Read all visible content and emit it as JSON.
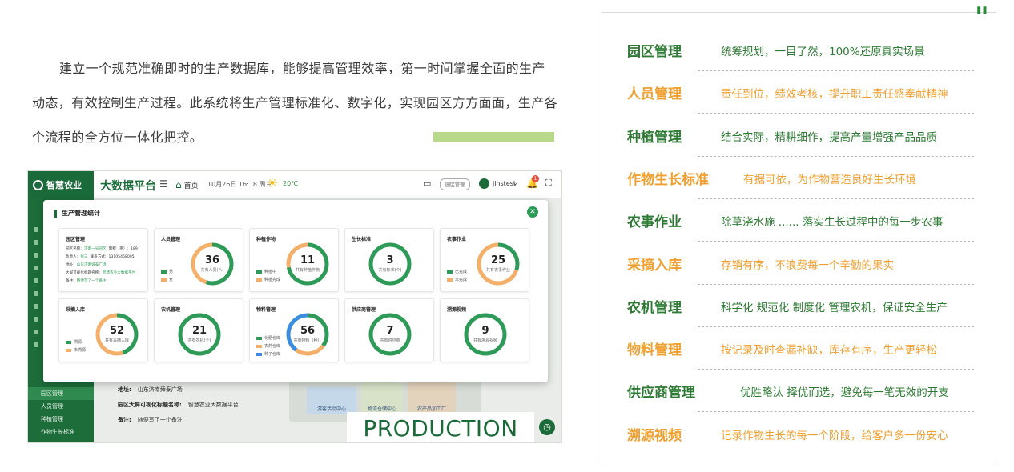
{
  "intro": {
    "text": "建立一个规范准确即时的生产数据库，能够提高管理效率，第一时间掌握全面的生产动态，有效控制生产过程。此系统将生产管理标准化、数字化，实现园区方方面面，生产各个流程的全方位一体化把控。"
  },
  "app": {
    "brand": "智慧农业",
    "platform": "大数据平台",
    "home_label": "首页",
    "datetime": "10月26日 16:18 周三",
    "temperature": "20℃",
    "park_button": "园区管理",
    "username": "jinstest",
    "notification_count": "1",
    "sidebar_menu": [
      {
        "label": "园区管理",
        "active": true
      },
      {
        "label": "人员管理",
        "active": false
      },
      {
        "label": "种植管理",
        "active": false
      },
      {
        "label": "作物生长标准",
        "active": false
      }
    ],
    "background_info": {
      "address_label": "地址:",
      "address_value": "山东济南舜泰广场",
      "screen_label": "园区大屏可视化标题名称:",
      "screen_value": "智慧农业大数据平台",
      "note_label": "备注:",
      "note_value": "随便写了一个备注"
    },
    "map_labels": [
      "游客活动中心",
      "物流仓储中心",
      "农产品加工厂"
    ],
    "production_text": "PRODUCTION",
    "modal": {
      "title": "生产管理统计",
      "park_card": {
        "title": "园区管理",
        "lines": [
          {
            "label": "园区名称:",
            "value": "济南一号园区",
            "extra": "面积（亩）:",
            "extra_value": "189"
          },
          {
            "label": "负责人:",
            "value": "张三",
            "extra": "联系方式:",
            "extra_value": "13105468005"
          },
          {
            "label": "地址:",
            "value": "山东济南舜泰广场",
            "extra": "",
            "extra_value": ""
          },
          {
            "label": "大屏可视化标题名称:",
            "value": "智慧农业大数据平台",
            "extra": "",
            "extra_value": ""
          },
          {
            "label": "备注:",
            "value": "随便写了一个备注",
            "extra": "",
            "extra_value": ""
          }
        ]
      },
      "cards": [
        {
          "title": "人员管理",
          "value": "36",
          "caption": "共有人员(人)",
          "segments": [
            {
              "frac": 0.55,
              "color": "#2e9a57"
            },
            {
              "frac": 0.45,
              "color": "#f4b06a"
            }
          ],
          "legend": [
            {
              "label": "男",
              "color": "#2e9a57"
            },
            {
              "label": "女",
              "color": "#f4b06a"
            }
          ]
        },
        {
          "title": "种植作物",
          "value": "11",
          "caption": "共有种植作物",
          "segments": [
            {
              "frac": 0.72,
              "color": "#2e9a57"
            },
            {
              "frac": 0.28,
              "color": "#f4b06a"
            }
          ],
          "legend": [
            {
              "label": "种植中",
              "color": "#2e9a57"
            },
            {
              "label": "种植完成",
              "color": "#f4b06a"
            }
          ]
        },
        {
          "title": "生长标准",
          "value": "3",
          "caption": "共有标准(个)",
          "segments": [
            {
              "frac": 1.0,
              "color": "#2e9a57"
            }
          ],
          "legend": []
        },
        {
          "title": "农事作业",
          "value": "25",
          "caption": "共有农事作业",
          "segments": [
            {
              "frac": 0.3,
              "color": "#2e9a57"
            },
            {
              "frac": 0.7,
              "color": "#f4b06a"
            }
          ],
          "legend": [
            {
              "label": "已完成",
              "color": "#2e9a57"
            },
            {
              "label": "未完成",
              "color": "#f4b06a"
            }
          ]
        },
        {
          "title": "采摘入库",
          "value": "52",
          "caption": "共有采摘入库",
          "segments": [
            {
              "frac": 0.45,
              "color": "#2e9a57"
            },
            {
              "frac": 0.55,
              "color": "#f4b06a"
            }
          ],
          "legend": [
            {
              "label": "溯源",
              "color": "#2e9a57"
            },
            {
              "label": "未溯源",
              "color": "#f4b06a"
            }
          ]
        },
        {
          "title": "农机管理",
          "value": "21",
          "caption": "共有农机(个)",
          "segments": [
            {
              "frac": 1.0,
              "color": "#2e9a57"
            }
          ],
          "legend": []
        },
        {
          "title": "物料管理",
          "value": "56",
          "caption": "共有物料（种）",
          "segments": [
            {
              "frac": 0.35,
              "color": "#2e9a57"
            },
            {
              "frac": 0.25,
              "color": "#f4b06a"
            },
            {
              "frac": 0.4,
              "color": "#3b8de0"
            }
          ],
          "legend": [
            {
              "label": "化肥仓库",
              "color": "#2e9a57"
            },
            {
              "label": "农药仓库",
              "color": "#f4b06a"
            },
            {
              "label": "种子仓库",
              "color": "#3b8de0"
            }
          ]
        },
        {
          "title": "供应商管理",
          "value": "7",
          "caption": "共有供应商",
          "segments": [
            {
              "frac": 1.0,
              "color": "#2e9a57"
            }
          ],
          "legend": []
        },
        {
          "title": "溯源视频",
          "value": "9",
          "caption": "共有溯源视频",
          "segments": [
            {
              "frac": 1.0,
              "color": "#2e9a57"
            }
          ],
          "legend": []
        }
      ]
    }
  },
  "features": [
    {
      "name": "园区管理",
      "desc": "统筹规划，一目了然，100%还原真实场景",
      "color": "green"
    },
    {
      "name": "人员管理",
      "desc": "责任到位，绩效考核，提升职工责任感奉献精神",
      "color": "orange"
    },
    {
      "name": "种植管理",
      "desc": "结合实际，精耕细作，提高产量增强产品品质",
      "color": "green"
    },
    {
      "name": "作物生长标准",
      "desc": "有据可依，为作物营造良好生长环境",
      "color": "orange"
    },
    {
      "name": "农事作业",
      "desc": "除草浇水施 ...... 落实生长过程中的每一步农事",
      "color": "green"
    },
    {
      "name": "采摘入库",
      "desc": "存销有序，不浪费每一个辛勤的果实",
      "color": "orange"
    },
    {
      "name": "农机管理",
      "desc": "科学化 规范化 制度化 管理农机，保证安全生产",
      "color": "green"
    },
    {
      "name": "物料管理",
      "desc": "按记录及时查漏补缺，库存有序，生产更轻松",
      "color": "orange"
    },
    {
      "name": "供应商管理",
      "desc": "优胜略汰 择优而选，避免每一笔无效的开支",
      "color": "green"
    },
    {
      "name": "溯源视频",
      "desc": "记录作物生长的每一个阶段，给客户多一份安心",
      "color": "orange"
    }
  ],
  "quote_mark": "\"",
  "icons": [
    "logo-icon",
    "menu-icon",
    "home-icon",
    "sun-icon",
    "monitor-icon",
    "bell-icon",
    "fullscreen-icon",
    "close-icon",
    "clock-icon"
  ]
}
